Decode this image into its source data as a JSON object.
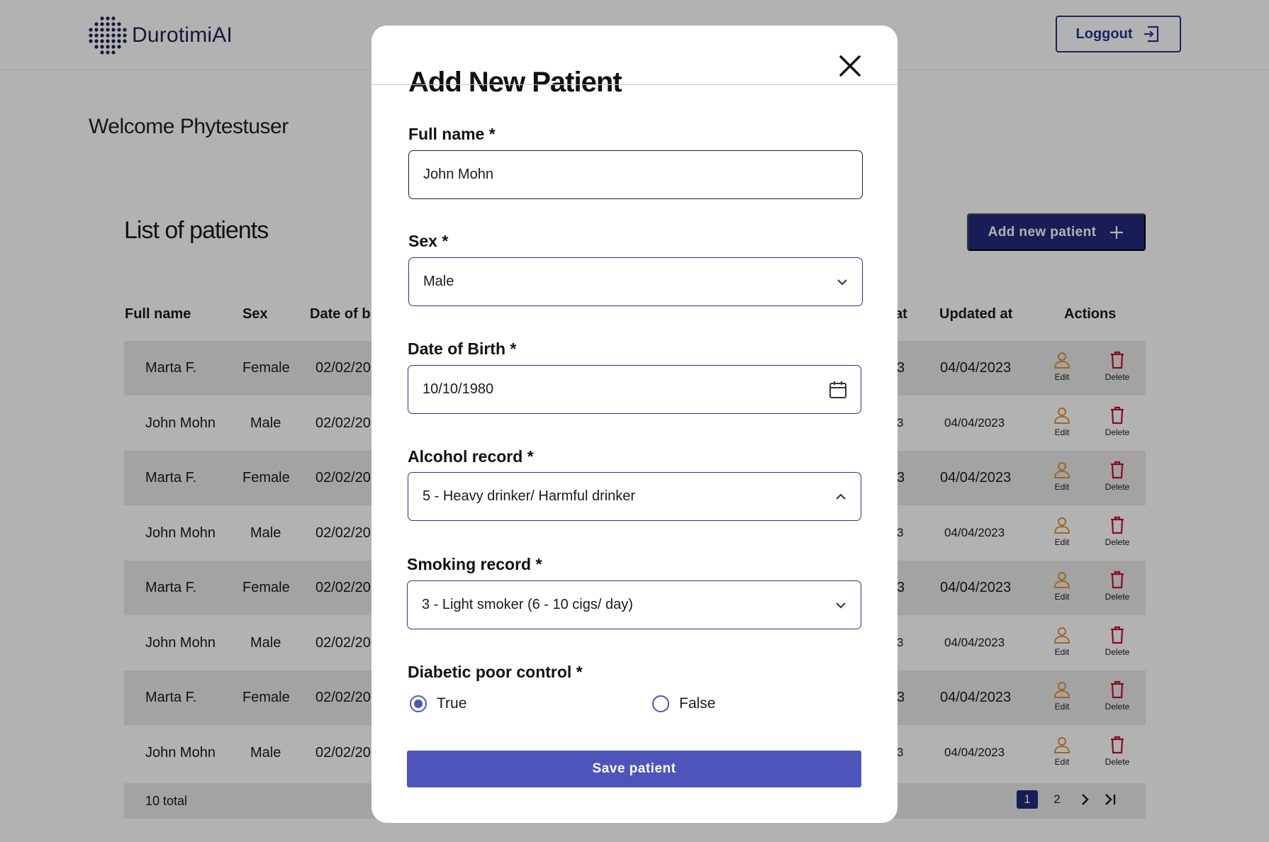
{
  "app": {
    "logo_text": "DurotimiAI",
    "logout_label": "Loggout",
    "welcome": "Welcome Phytestuser"
  },
  "patients": {
    "title": "List of patients",
    "add_label": "Add new patient",
    "columns": [
      "Full name",
      "Sex",
      "Date of b",
      "at",
      "Updated at",
      "Actions"
    ],
    "rows": [
      {
        "name": "Marta F.",
        "sex": "Female",
        "dob": "02/02/20",
        "created": "3",
        "updated": "04/04/2023"
      },
      {
        "name": "John Mohn",
        "sex": "Male",
        "dob": "02/02/20",
        "created": "3",
        "updated": "04/04/2023"
      },
      {
        "name": "Marta F.",
        "sex": "Female",
        "dob": "02/02/20",
        "created": "3",
        "updated": "04/04/2023"
      },
      {
        "name": "John Mohn",
        "sex": "Male",
        "dob": "02/02/20",
        "created": "3",
        "updated": "04/04/2023"
      },
      {
        "name": "Marta F.",
        "sex": "Female",
        "dob": "02/02/20",
        "created": "3",
        "updated": "04/04/2023"
      },
      {
        "name": "John Mohn",
        "sex": "Male",
        "dob": "02/02/20",
        "created": "3",
        "updated": "04/04/2023"
      },
      {
        "name": "Marta F.",
        "sex": "Female",
        "dob": "02/02/20",
        "created": "3",
        "updated": "04/04/2023"
      },
      {
        "name": "John Mohn",
        "sex": "Male",
        "dob": "02/02/20",
        "created": "3",
        "updated": "04/04/2023"
      }
    ],
    "edit_label": "Edit",
    "delete_label": "Delete",
    "total": "10 total",
    "pages": [
      "1",
      "2"
    ],
    "current_page": "1"
  },
  "modal": {
    "title": "Add New Patient",
    "full_name_label": "Full name *",
    "full_name_value": "John Mohn",
    "sex_label": "Sex *",
    "sex_value": "Male",
    "dob_label": "Date of Birth *",
    "dob_value": "10/10/1980",
    "alcohol_label": "Alcohol record *",
    "alcohol_value": "5 - Heavy drinker/ Harmful drinker",
    "smoking_label": "Smoking record *",
    "smoking_value": "3 - Light smoker (6 - 10 cigs/ day)",
    "diabetic_label": "Diabetic poor control *",
    "option_true": "True",
    "option_false": "False",
    "selected_option": "True",
    "save_label": "Save patient"
  },
  "colors": {
    "primary": "#232a7a",
    "accent": "#4d55bc",
    "edit": "#e0953a",
    "delete": "#c8102e",
    "overlay": "rgba(0,0,0,0.30)"
  },
  "icons": [
    "logo-dots-icon",
    "logout-icon",
    "plus-icon",
    "edit-user-icon",
    "trash-icon",
    "chevron-right-icon",
    "last-page-icon",
    "close-icon",
    "chevron-down-icon",
    "chevron-up-icon",
    "calendar-icon"
  ]
}
